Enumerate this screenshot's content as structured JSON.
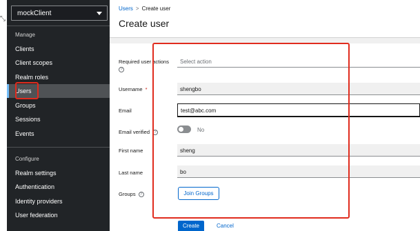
{
  "gutter": {
    "mark": "⤡"
  },
  "sidebar": {
    "realm": "mockClient",
    "sections": [
      {
        "title": "Manage",
        "items": [
          "Clients",
          "Client scopes",
          "Realm roles",
          "Users",
          "Groups",
          "Sessions",
          "Events"
        ]
      },
      {
        "title": "Configure",
        "items": [
          "Realm settings",
          "Authentication",
          "Identity providers",
          "User federation"
        ]
      }
    ],
    "active_item": "Users"
  },
  "breadcrumb": {
    "parent": "Users",
    "separator": ">",
    "current": "Create user"
  },
  "page_title": "Create user",
  "form": {
    "required_actions": {
      "label": "Required user actions",
      "placeholder": "Select action"
    },
    "username": {
      "label": "Username",
      "required_mark": "*",
      "value": "shengbo"
    },
    "email": {
      "label": "Email",
      "value": "test@abc.com"
    },
    "email_verified": {
      "label": "Email verified",
      "state": "No"
    },
    "first_name": {
      "label": "First name",
      "value": "sheng"
    },
    "last_name": {
      "label": "Last name",
      "value": "bo"
    },
    "groups": {
      "label": "Groups",
      "button": "Join Groups"
    }
  },
  "actions": {
    "create": "Create",
    "cancel": "Cancel"
  },
  "colors": {
    "sidebar_bg": "#212427",
    "primary": "#0066cc",
    "highlight_box": "#e02b1d"
  }
}
